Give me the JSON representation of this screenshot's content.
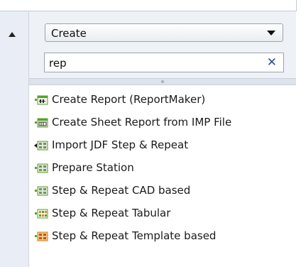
{
  "panel": {
    "collapse_icon": "triangle-up-icon"
  },
  "dropdown": {
    "selected": "Create",
    "icon": "chevron-down-icon"
  },
  "search": {
    "value": "rep",
    "clear_icon": "close-icon"
  },
  "list": {
    "items": [
      {
        "label": "Create Report (ReportMaker)",
        "icon": "report-icon"
      },
      {
        "label": "Create Sheet Report from IMP File",
        "icon": "sheet-report-icon"
      },
      {
        "label": "Import JDF Step & Repeat",
        "icon": "import-step-repeat-icon"
      },
      {
        "label": "Prepare Station",
        "icon": "step-repeat-grid-icon"
      },
      {
        "label": "Step & Repeat CAD based",
        "icon": "step-repeat-grid-icon"
      },
      {
        "label": "Step & Repeat Tabular",
        "icon": "step-repeat-tabular-icon"
      },
      {
        "label": "Step & Repeat Template based",
        "icon": "step-repeat-template-icon"
      }
    ]
  },
  "colors": {
    "accent": "#2f4f8f",
    "icon_green": "#5aa02c",
    "icon_orange": "#e58a1f"
  }
}
